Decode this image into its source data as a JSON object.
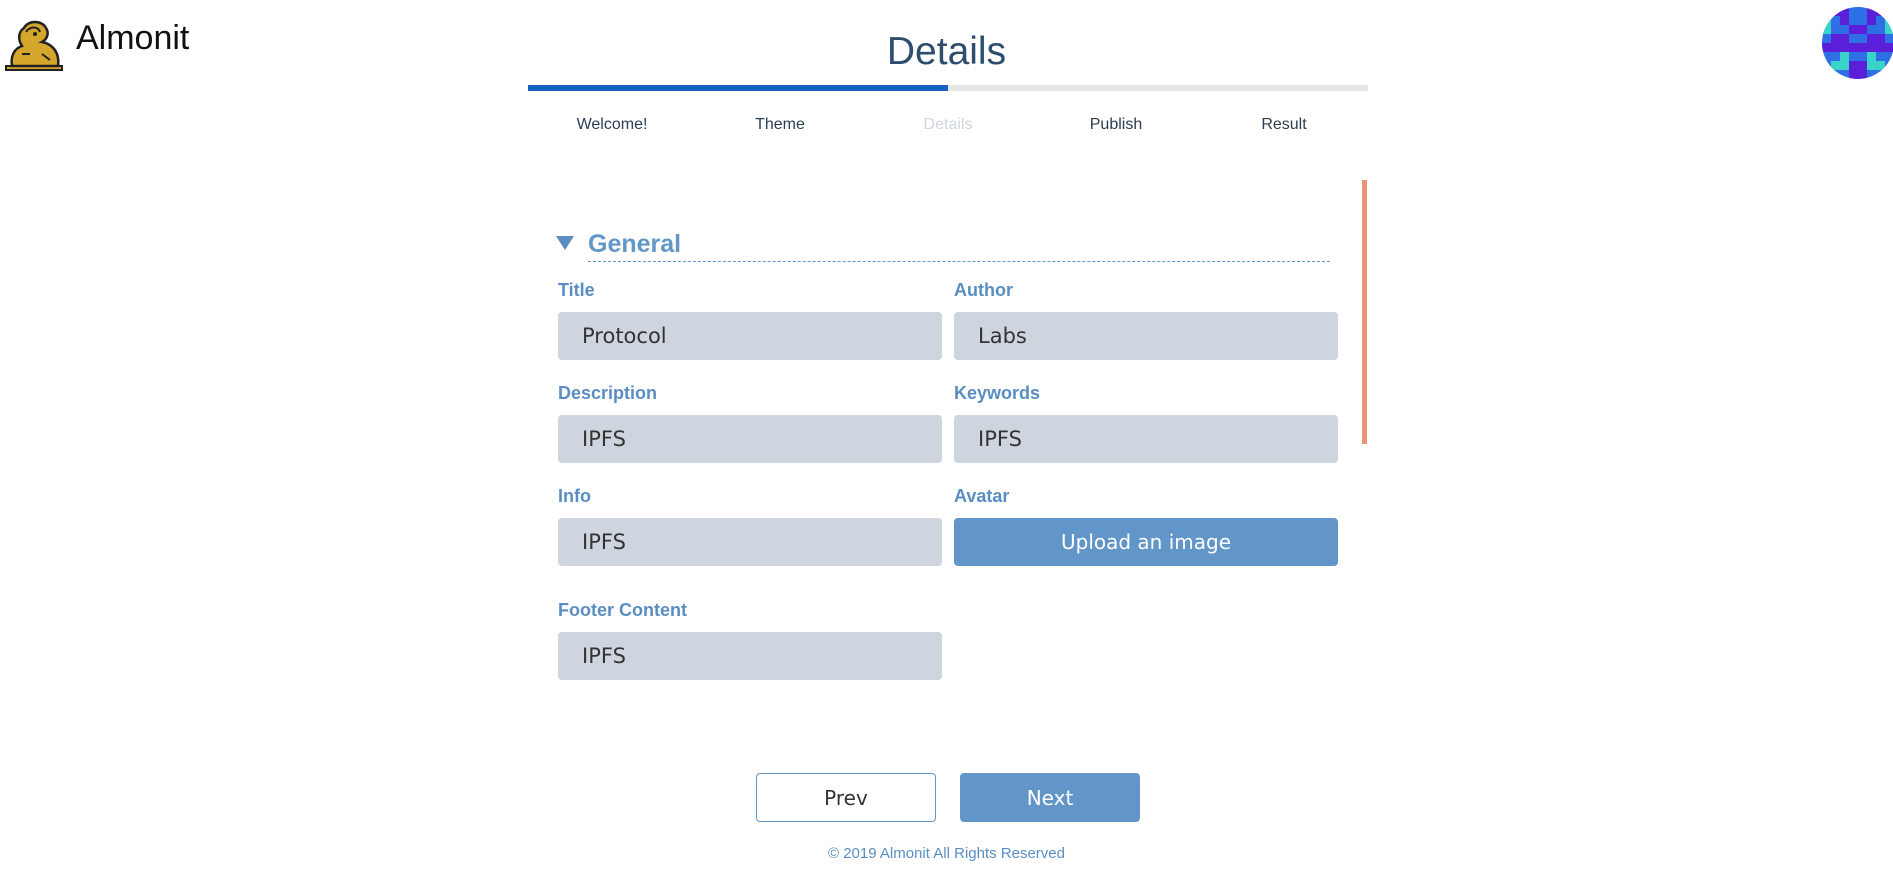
{
  "header": {
    "brand_name": "Almonit",
    "logo_icon": "lion-icon",
    "avatar_icon": "identicon-avatar",
    "page_title": "Details"
  },
  "wizard": {
    "progress": 0.5,
    "steps": [
      {
        "label": "Welcome!",
        "state": "done"
      },
      {
        "label": "Theme",
        "state": "done"
      },
      {
        "label": "Details",
        "state": "current"
      },
      {
        "label": "Publish",
        "state": "todo"
      },
      {
        "label": "Result",
        "state": "todo"
      }
    ]
  },
  "form": {
    "section_title": "General",
    "fields": {
      "title": {
        "label": "Title",
        "value": "Protocol"
      },
      "author": {
        "label": "Author",
        "value": "Labs"
      },
      "description": {
        "label": "Description",
        "value": "IPFS"
      },
      "keywords": {
        "label": "Keywords",
        "value": "IPFS"
      },
      "info": {
        "label": "Info",
        "value": "IPFS"
      },
      "avatar": {
        "label": "Avatar",
        "button_label": "Upload an image"
      },
      "footer_content": {
        "label": "Footer Content",
        "value": "IPFS"
      }
    }
  },
  "nav": {
    "prev_label": "Prev",
    "next_label": "Next"
  },
  "footer": {
    "copyright": "© 2019 Almonit All Rights Reserved"
  },
  "colors": {
    "accent": "#6396c8",
    "progress": "#1565c0",
    "input_bg": "#cfd5df",
    "scrollbar": "#e8967a",
    "title": "#2c4d6e"
  }
}
